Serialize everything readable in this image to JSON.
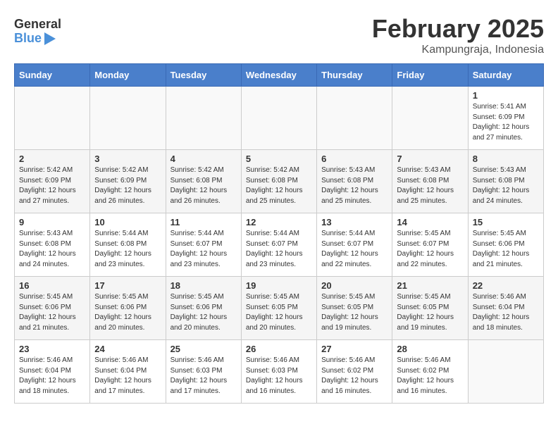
{
  "header": {
    "logo_general": "General",
    "logo_blue": "Blue",
    "month_year": "February 2025",
    "location": "Kampungraja, Indonesia"
  },
  "weekdays": [
    "Sunday",
    "Monday",
    "Tuesday",
    "Wednesday",
    "Thursday",
    "Friday",
    "Saturday"
  ],
  "weeks": [
    [
      {
        "day": "",
        "info": ""
      },
      {
        "day": "",
        "info": ""
      },
      {
        "day": "",
        "info": ""
      },
      {
        "day": "",
        "info": ""
      },
      {
        "day": "",
        "info": ""
      },
      {
        "day": "",
        "info": ""
      },
      {
        "day": "1",
        "info": "Sunrise: 5:41 AM\nSunset: 6:09 PM\nDaylight: 12 hours\nand 27 minutes."
      }
    ],
    [
      {
        "day": "2",
        "info": "Sunrise: 5:42 AM\nSunset: 6:09 PM\nDaylight: 12 hours\nand 27 minutes."
      },
      {
        "day": "3",
        "info": "Sunrise: 5:42 AM\nSunset: 6:09 PM\nDaylight: 12 hours\nand 26 minutes."
      },
      {
        "day": "4",
        "info": "Sunrise: 5:42 AM\nSunset: 6:08 PM\nDaylight: 12 hours\nand 26 minutes."
      },
      {
        "day": "5",
        "info": "Sunrise: 5:42 AM\nSunset: 6:08 PM\nDaylight: 12 hours\nand 25 minutes."
      },
      {
        "day": "6",
        "info": "Sunrise: 5:43 AM\nSunset: 6:08 PM\nDaylight: 12 hours\nand 25 minutes."
      },
      {
        "day": "7",
        "info": "Sunrise: 5:43 AM\nSunset: 6:08 PM\nDaylight: 12 hours\nand 25 minutes."
      },
      {
        "day": "8",
        "info": "Sunrise: 5:43 AM\nSunset: 6:08 PM\nDaylight: 12 hours\nand 24 minutes."
      }
    ],
    [
      {
        "day": "9",
        "info": "Sunrise: 5:43 AM\nSunset: 6:08 PM\nDaylight: 12 hours\nand 24 minutes."
      },
      {
        "day": "10",
        "info": "Sunrise: 5:44 AM\nSunset: 6:08 PM\nDaylight: 12 hours\nand 23 minutes."
      },
      {
        "day": "11",
        "info": "Sunrise: 5:44 AM\nSunset: 6:07 PM\nDaylight: 12 hours\nand 23 minutes."
      },
      {
        "day": "12",
        "info": "Sunrise: 5:44 AM\nSunset: 6:07 PM\nDaylight: 12 hours\nand 23 minutes."
      },
      {
        "day": "13",
        "info": "Sunrise: 5:44 AM\nSunset: 6:07 PM\nDaylight: 12 hours\nand 22 minutes."
      },
      {
        "day": "14",
        "info": "Sunrise: 5:45 AM\nSunset: 6:07 PM\nDaylight: 12 hours\nand 22 minutes."
      },
      {
        "day": "15",
        "info": "Sunrise: 5:45 AM\nSunset: 6:06 PM\nDaylight: 12 hours\nand 21 minutes."
      }
    ],
    [
      {
        "day": "16",
        "info": "Sunrise: 5:45 AM\nSunset: 6:06 PM\nDaylight: 12 hours\nand 21 minutes."
      },
      {
        "day": "17",
        "info": "Sunrise: 5:45 AM\nSunset: 6:06 PM\nDaylight: 12 hours\nand 20 minutes."
      },
      {
        "day": "18",
        "info": "Sunrise: 5:45 AM\nSunset: 6:06 PM\nDaylight: 12 hours\nand 20 minutes."
      },
      {
        "day": "19",
        "info": "Sunrise: 5:45 AM\nSunset: 6:05 PM\nDaylight: 12 hours\nand 20 minutes."
      },
      {
        "day": "20",
        "info": "Sunrise: 5:45 AM\nSunset: 6:05 PM\nDaylight: 12 hours\nand 19 minutes."
      },
      {
        "day": "21",
        "info": "Sunrise: 5:45 AM\nSunset: 6:05 PM\nDaylight: 12 hours\nand 19 minutes."
      },
      {
        "day": "22",
        "info": "Sunrise: 5:46 AM\nSunset: 6:04 PM\nDaylight: 12 hours\nand 18 minutes."
      }
    ],
    [
      {
        "day": "23",
        "info": "Sunrise: 5:46 AM\nSunset: 6:04 PM\nDaylight: 12 hours\nand 18 minutes."
      },
      {
        "day": "24",
        "info": "Sunrise: 5:46 AM\nSunset: 6:04 PM\nDaylight: 12 hours\nand 17 minutes."
      },
      {
        "day": "25",
        "info": "Sunrise: 5:46 AM\nSunset: 6:03 PM\nDaylight: 12 hours\nand 17 minutes."
      },
      {
        "day": "26",
        "info": "Sunrise: 5:46 AM\nSunset: 6:03 PM\nDaylight: 12 hours\nand 16 minutes."
      },
      {
        "day": "27",
        "info": "Sunrise: 5:46 AM\nSunset: 6:02 PM\nDaylight: 12 hours\nand 16 minutes."
      },
      {
        "day": "28",
        "info": "Sunrise: 5:46 AM\nSunset: 6:02 PM\nDaylight: 12 hours\nand 16 minutes."
      },
      {
        "day": "",
        "info": ""
      }
    ]
  ]
}
